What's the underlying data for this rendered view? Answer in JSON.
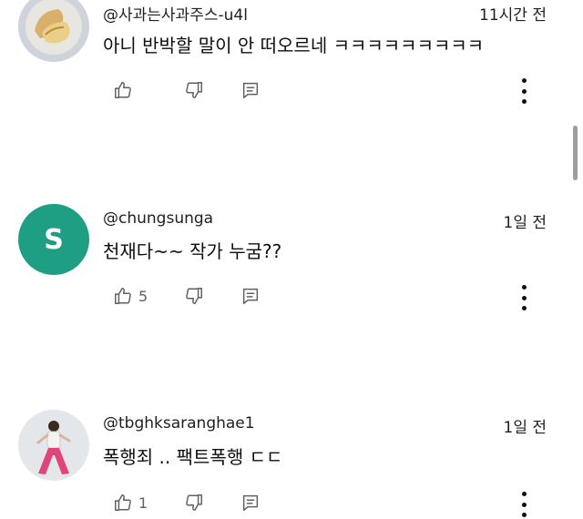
{
  "colors": {
    "avatar_s_bg": "#1e9e83",
    "icon_gray": "#606060"
  },
  "comments": [
    {
      "author": "@사과는사과주스-u4l",
      "time": "11시간 전",
      "text": "아니 반박할 말이 안 떠오르네 ㅋㅋㅋㅋㅋㅋㅋㅋㅋ",
      "likes": "",
      "avatar_letter": "",
      "avatar_icon": "apple-slices-photo"
    },
    {
      "author": "@chungsunga",
      "time": "1일 전",
      "text": "천재다~~ 작가 누굼??",
      "likes": "5",
      "avatar_letter": "S",
      "avatar_icon": ""
    },
    {
      "author": "@tbghksaranghae1",
      "time": "1일 전",
      "text": "폭행죄 .. 팩트폭행 ㄷㄷ",
      "likes": "1",
      "avatar_letter": "",
      "avatar_icon": "person-photo"
    }
  ],
  "icons": {
    "like": "thumbs-up-icon",
    "dislike": "thumbs-down-icon",
    "reply": "reply-comment-icon",
    "more": "more-vert-icon"
  }
}
